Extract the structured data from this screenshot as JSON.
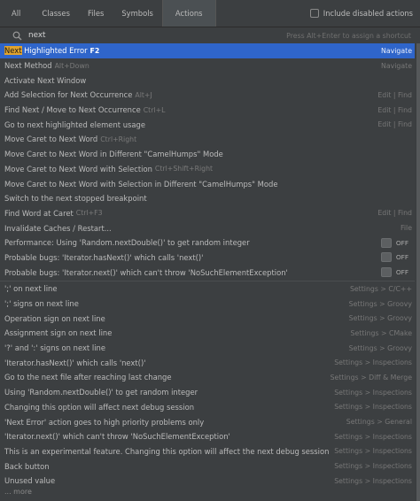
{
  "tabs": [
    {
      "label": "All"
    },
    {
      "label": "Classes"
    },
    {
      "label": "Files"
    },
    {
      "label": "Symbols"
    },
    {
      "label": "Actions"
    }
  ],
  "include_disabled_label": "Include disabled actions",
  "search": {
    "value": "next",
    "hint": "Press Alt+Enter to assign a shortcut"
  },
  "selected_row": {
    "match": "Next",
    "rest": " Highlighted Error",
    "shortcut": "F2",
    "right": "Navigate"
  },
  "rows": [
    {
      "label": "Next Method",
      "shortcut": "Alt+Down",
      "right": "Navigate"
    },
    {
      "label": "Activate Next Window",
      "shortcut": "",
      "right": ""
    },
    {
      "label": "Add Selection for Next Occurrence",
      "shortcut": "Alt+J",
      "right": "Edit | Find"
    },
    {
      "label": "Find Next / Move to Next Occurrence",
      "shortcut": "Ctrl+L",
      "right": "Edit | Find"
    },
    {
      "label": "Go to next highlighted element usage",
      "shortcut": "",
      "right": "Edit | Find"
    },
    {
      "label": "Move Caret to Next Word",
      "shortcut": "Ctrl+Right",
      "right": ""
    },
    {
      "label": "Move Caret to Next Word in Different \"CamelHumps\" Mode",
      "shortcut": "",
      "right": ""
    },
    {
      "label": "Move Caret to Next Word with Selection",
      "shortcut": "Ctrl+Shift+Right",
      "right": ""
    },
    {
      "label": "Move Caret to Next Word with Selection in Different \"CamelHumps\" Mode",
      "shortcut": "",
      "right": ""
    },
    {
      "label": "Switch to the next stopped breakpoint",
      "shortcut": "",
      "right": ""
    },
    {
      "label": "Find Word at Caret",
      "shortcut": "Ctrl+F3",
      "right": "Edit | Find"
    },
    {
      "label": "Invalidate Caches / Restart...",
      "shortcut": "",
      "right": "File"
    }
  ],
  "toggle_rows": [
    {
      "label": "Performance: Using 'Random.nextDouble()' to get random integer",
      "state": "OFF"
    },
    {
      "label": "Probable bugs: 'Iterator.hasNext()' which calls 'next()'",
      "state": "OFF"
    },
    {
      "label": "Probable bugs: 'Iterator.next()' which can't throw 'NoSuchElementException'",
      "state": "OFF"
    }
  ],
  "settings_rows": [
    {
      "label": "';' on next line",
      "right": "Settings > C/C++"
    },
    {
      "label": "';' signs on next line",
      "right": "Settings > Groovy"
    },
    {
      "label": "Operation sign on next line",
      "right": "Settings > Groovy"
    },
    {
      "label": "Assignment sign on next line",
      "right": "Settings > CMake"
    },
    {
      "label": "'?' and ':' signs on next line",
      "right": "Settings > Groovy"
    },
    {
      "label": "'Iterator.hasNext()' which calls 'next()'",
      "right": "Settings > Inspections"
    },
    {
      "label": "Go to the next file after reaching last change",
      "right": "Settings > Diff & Merge"
    },
    {
      "label": "Using 'Random.nextDouble()' to get random integer",
      "right": "Settings > Inspections"
    },
    {
      "label": "Changing this option will affect next debug session",
      "right": "Settings > Inspections"
    },
    {
      "label": "'Next Error' action goes to high priority problems only",
      "right": "Settings > General"
    },
    {
      "label": "'Iterator.next()' which can't throw 'NoSuchElementException'",
      "right": "Settings > Inspections"
    },
    {
      "label": "This is an experimental feature. Changing this option will affect the next debug session",
      "right": "Settings > Inspections"
    },
    {
      "label": "Back button",
      "right": "Settings > Inspections"
    },
    {
      "label": "Unused value",
      "right": "Settings > Inspections"
    }
  ],
  "more_label": "... more"
}
